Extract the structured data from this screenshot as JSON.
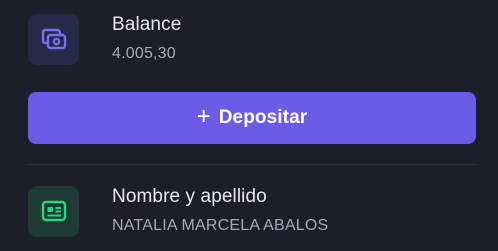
{
  "balance": {
    "icon": "money-icon",
    "label": "Balance",
    "value": "4.005,30"
  },
  "deposit_button": {
    "icon": "plus-icon",
    "label": "Depositar"
  },
  "full_name": {
    "icon": "id-card-icon",
    "label": "Nombre y apellido",
    "value": "NATALIA MARCELA ABALOS"
  },
  "colors": {
    "background": "#1c1f2a",
    "accent": "#6b5ce7",
    "balance_icon": "#7b6cf0",
    "id_icon": "#2ed47a"
  }
}
